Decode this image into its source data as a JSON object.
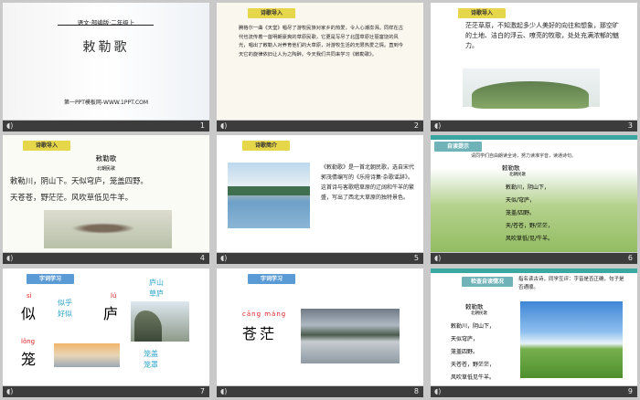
{
  "slides": [
    {
      "num": "1",
      "sub": "语文·部编版·二年级上",
      "title": "敕勒歌",
      "footer": "第一PPT模板网-WWW.1PPT.COM"
    },
    {
      "num": "2",
      "tag": "诗歌导入",
      "text": "腾格尔一曲《天堂》唱尽了游牧民族对家乡的热爱，令人心潮澎湃。同样在古代也流传着一首明朗豪爽的草原民歌，它更是写尽了北国草原壮丽富饶的风光，唱出了敕勒人对养育他们的大草原，对游牧生活的无限热爱之情。直到今天它的旋律依旧让人为之陶醉。今天我们共同来学习《敕勒歌》。"
    },
    {
      "num": "3",
      "tag": "诗歌导入",
      "text": "茫茫草原，不知激起多少人美好的向往和想象，那空旷的土地、洁白的浮云、嘹亮的牧歌，处处充满浓郁的魅力。"
    },
    {
      "num": "4",
      "tag": "诗歌导入",
      "title": "敕勒歌",
      "dynasty": "北朝民歌",
      "lines": [
        "敕勒川，阴山下。天似穹庐，笼盖四野。",
        "天苍苍，野茫茫。风吹草低见牛羊。"
      ]
    },
    {
      "num": "5",
      "tag": "诗歌简介",
      "text": "《敕勒歌》是一首北朝民歌，选自宋代郭茂倩编写的《乐府诗集·杂歌谣辞》。这首诗与客歌唱草原的辽阔和牛羊的繁盛，写出了西北大草原的独特景色。"
    },
    {
      "num": "6",
      "tag": "自读提示",
      "hint": "请同学们自由朗读全诗，努力读准字音，读通诗句。",
      "title": "敕勒歌",
      "dynasty": "北朝民歌",
      "lines": [
        "敕勒川，阴山下，",
        "天似/穹庐，",
        "笼盖/四野。",
        "天/苍苍，野/茫茫，",
        "风吹草低/见/牛羊。"
      ]
    },
    {
      "num": "7",
      "tag": "字词学习",
      "p1": "sì",
      "c1": "似",
      "w1": "似乎\n好似",
      "p2": "lú",
      "c2": "庐",
      "w2": "庐山\n草庐",
      "p3": "lǒng",
      "c3": "笼",
      "w3": "笼盖\n笼罩"
    },
    {
      "num": "8",
      "tag": "字词学习",
      "pinyin": "cāng máng",
      "word": "苍茫"
    },
    {
      "num": "9",
      "tag": "检查自读情况",
      "hint": "指名读古诗，同学互评：字音是否正确，句子是否通顺。",
      "title": "敕勒歌",
      "dynasty": "北朝民歌",
      "lines": [
        "敕勒川，阴山下，",
        "天似穹庐，",
        "笼盖四野。",
        "天苍苍，野茫茫，",
        "风吹草低见牛羊。"
      ]
    }
  ],
  "icon": "speaker-icon"
}
